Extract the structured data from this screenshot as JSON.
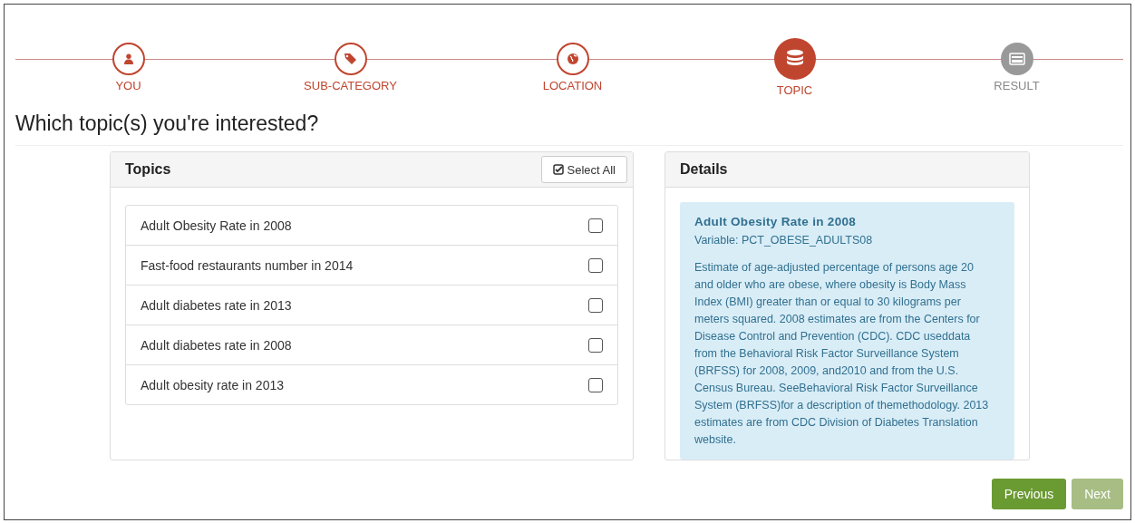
{
  "steps": [
    {
      "label": "YOU",
      "completed": true,
      "selected": false
    },
    {
      "label": "SUB-CATEGORY",
      "completed": true,
      "selected": false
    },
    {
      "label": "LOCATION",
      "completed": true,
      "selected": false
    },
    {
      "label": "TOPIC",
      "completed": false,
      "selected": true
    },
    {
      "label": "RESULT",
      "completed": false,
      "selected": false
    }
  ],
  "heading": "Which topic(s) you're interested?",
  "topics": {
    "title": "Topics",
    "select_all": "Select All",
    "items": [
      {
        "label": "Adult Obesity Rate in 2008",
        "checked": false
      },
      {
        "label": "Fast-food restaurants number in 2014",
        "checked": false
      },
      {
        "label": "Adult diabetes rate in 2013",
        "checked": false
      },
      {
        "label": "Adult diabetes rate in 2008",
        "checked": false
      },
      {
        "label": "Adult obesity rate in 2013",
        "checked": false
      }
    ]
  },
  "details": {
    "title": "Details",
    "name": "Adult Obesity Rate in 2008",
    "variable": "Variable: PCT_OBESE_ADULTS08",
    "description": "Estimate of age-adjusted percentage of persons age 20 and older who are obese, where obesity is Body Mass Index (BMI) greater than or equal to 30 kilograms per meters squared. 2008 estimates are from the Centers for Disease Control and Prevention (CDC). CDC useddata from the Behavioral Risk Factor Surveillance System (BRFSS) for 2008, 2009, and2010 and from the U.S. Census Bureau. SeeBehavioral Risk Factor Surveillance System (BRFSS)for a description of themethodology. 2013 estimates are from CDC Division of Diabetes Translation website."
  },
  "buttons": [
    {
      "label": "Previous",
      "disabled": false
    },
    {
      "label": "Next",
      "disabled": true
    }
  ]
}
